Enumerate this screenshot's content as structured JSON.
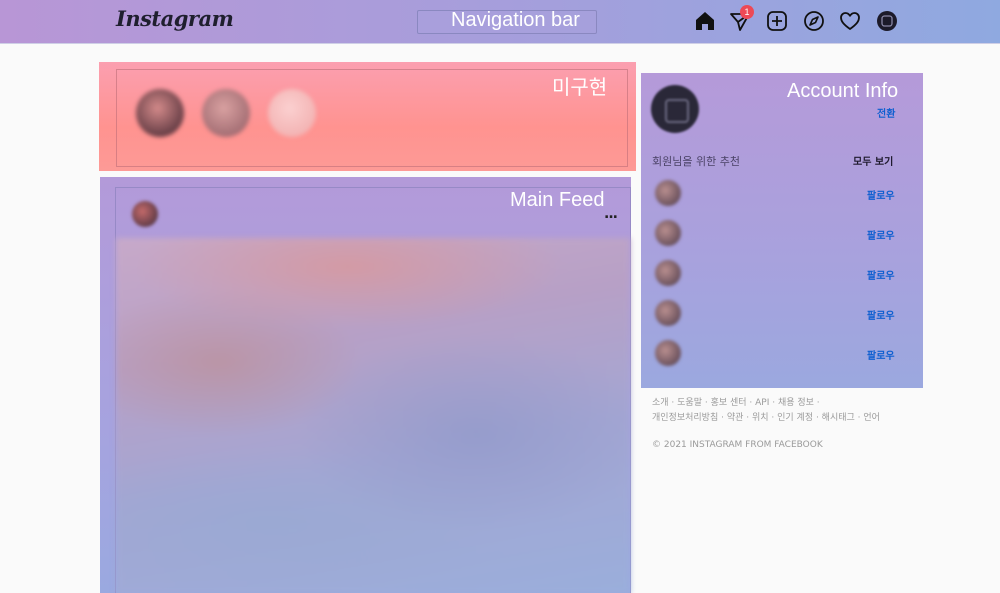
{
  "nav": {
    "logo": "Instagram",
    "title": "Navigation bar",
    "dm_badge": "1",
    "icons": [
      "home-icon",
      "direct-message-icon",
      "new-post-icon",
      "explore-icon",
      "activity-heart-icon",
      "profile-icon"
    ]
  },
  "stories": {
    "label": "미구현",
    "items": [
      {
        "name": "",
        "color": "#7a3a46"
      },
      {
        "name": "",
        "color": "#a7737b"
      },
      {
        "name": "",
        "color": "#f3b6b6"
      }
    ]
  },
  "feed": {
    "label": "Main Feed",
    "post": {
      "username": "",
      "more": "..."
    }
  },
  "account": {
    "label": "Account Info",
    "username": "",
    "fullname": "",
    "switch_label": "전환",
    "suggestions_title": "회원님을 위한 추천",
    "see_all": "모두 보기",
    "suggestions": [
      {
        "name": "",
        "desc": "",
        "follow": "팔로우"
      },
      {
        "name": "",
        "desc": "",
        "follow": "팔로우"
      },
      {
        "name": "",
        "desc": "",
        "follow": "팔로우"
      },
      {
        "name": "",
        "desc": "",
        "follow": "팔로우"
      },
      {
        "name": "",
        "desc": "",
        "follow": "팔로우"
      }
    ]
  },
  "footer": {
    "links_line1": "소개 · 도움말 · 홍보 센터 · API · 채용 정보 ·",
    "links_line2": "개인정보처리방침 · 약관 · 위치 · 인기 계정 · 해시태그 · 언어",
    "copyright": "© 2021 INSTAGRAM FROM FACEBOOK"
  },
  "colors": {
    "follow_blue": "#0f5fd0",
    "badge_red": "#ed4956"
  }
}
